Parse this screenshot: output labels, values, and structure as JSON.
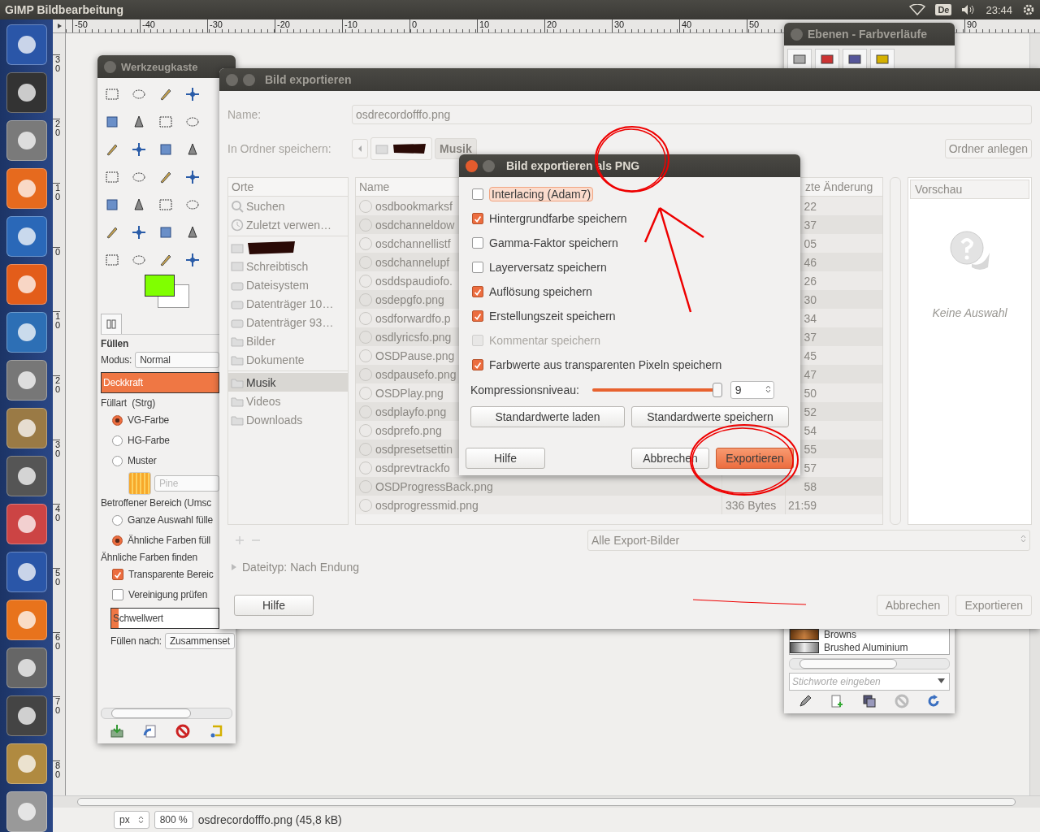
{
  "top_bar": {
    "title": "GIMP Bildbearbeitung",
    "keyboard_layout": "De",
    "clock": "23:44"
  },
  "ruler_top": {
    "labels": [
      "-50",
      "-40",
      "-30",
      "-20",
      "-10",
      "0",
      "10",
      "20",
      "30",
      "40",
      "50"
    ],
    "end_labels": [
      "90"
    ]
  },
  "ruler_left": {
    "labels": [
      "30",
      "20",
      "10",
      "0",
      "10",
      "20",
      "30",
      "40",
      "50",
      "60",
      "70",
      "80"
    ]
  },
  "toolbox": {
    "title": "Werkzeugkaste",
    "options_title": "Füllen",
    "mode_label": "Modus:",
    "mode": "Normal",
    "opacity": {
      "label": "Deckkraft",
      "level": 1
    },
    "fill_type_label": "Füllart  (Strg)",
    "fill_types": [
      {
        "label": "VG-Farbe",
        "selected": true
      },
      {
        "label": "HG-Farbe",
        "selected": false
      },
      {
        "label": "Muster",
        "selected": false
      }
    ],
    "pattern": "Pine",
    "area_label": "Betroffener Bereich (Umsc",
    "areas": [
      {
        "label": "Ganze Auswahl fülle",
        "selected": false
      },
      {
        "label": "Ähnliche Farben füll",
        "selected": true
      }
    ],
    "find_label": "Ähnliche Farben finden",
    "find_options": [
      {
        "label": "Transparente Bereic",
        "checked": true
      },
      {
        "label": "Vereinigung prüfen",
        "checked": false
      }
    ],
    "threshold": {
      "label": "Schwellwert",
      "level": 0.07
    },
    "fill_by_label": "Füllen nach:",
    "fill_by": "Zusammenset"
  },
  "layers_window": {
    "title": "Ebenen - Farbverläufe",
    "gradients": [
      "Browns",
      "Brushed Aluminium"
    ],
    "tag_placeholder": "Stichworte eingeben"
  },
  "export_dialog": {
    "title": "Bild exportieren",
    "name_label": "Name:",
    "name_value": "osdrecordofffo.png",
    "folder_label": "In Ordner speichern:",
    "path": [
      {
        "kind": "redacted",
        "selected": false
      },
      {
        "kind": "folder",
        "label": "Musik",
        "selected": true
      }
    ],
    "create_folder": "Ordner anlegen",
    "places_header": "Orte",
    "place_groups": [
      [
        {
          "kind": "search",
          "label": "Suchen",
          "selected": false
        },
        {
          "kind": "recent",
          "label": "Zuletzt verwen…",
          "selected": false
        }
      ],
      [
        {
          "kind": "redacted",
          "selected": false
        },
        {
          "kind": "desktop",
          "label": "Schreibtisch",
          "selected": false
        },
        {
          "kind": "drive",
          "label": "Dateisystem",
          "selected": false
        },
        {
          "kind": "drive",
          "label": "Datenträger 10…",
          "selected": false
        },
        {
          "kind": "drive",
          "label": "Datenträger 93…",
          "selected": false
        },
        {
          "kind": "folder",
          "label": "Bilder",
          "selected": false
        },
        {
          "kind": "folder",
          "label": "Dokumente",
          "selected": false
        }
      ],
      [
        {
          "kind": "folder",
          "label": "Musik",
          "selected": true
        },
        {
          "kind": "folder",
          "label": "Videos",
          "selected": false
        },
        {
          "kind": "folder",
          "label": "Downloads",
          "selected": false
        }
      ]
    ],
    "columns": {
      "name": "Name",
      "modified": "zte Änderung"
    },
    "files": [
      {
        "name": "osdbookmarksf",
        "modified": "22"
      },
      {
        "name": "osdchanneldow",
        "modified": "37"
      },
      {
        "name": "osdchannellistf",
        "modified": "05"
      },
      {
        "name": "osdchannelupf",
        "modified": "46"
      },
      {
        "name": "osddspaudiofo.",
        "modified": "26"
      },
      {
        "name": "osdepgfo.png",
        "modified": "30"
      },
      {
        "name": "osdforwardfo.p",
        "modified": "34"
      },
      {
        "name": "osdlyricsfo.png",
        "modified": "37"
      },
      {
        "name": "OSDPause.png",
        "modified": "45"
      },
      {
        "name": "osdpausefo.png",
        "modified": "47"
      },
      {
        "name": "OSDPlay.png",
        "modified": "50"
      },
      {
        "name": "osdplayfo.png",
        "modified": "52"
      },
      {
        "name": "osdprefo.png",
        "modified": "54"
      },
      {
        "name": "osdpresetsettin",
        "modified": "55"
      },
      {
        "name": "osdprevtrackfo",
        "modified": "57"
      },
      {
        "name": "OSDProgressBack.png",
        "modified": "58"
      },
      {
        "name": "osdprogressmid.png",
        "size": "336 Bytes",
        "modified": "21:59"
      }
    ],
    "preview_header": "Vorschau",
    "preview_empty": "Keine Auswahl",
    "filter": "Alle Export-Bilder",
    "file_type": "Dateityp: Nach Endung",
    "help": "Hilfe",
    "cancel": "Abbrechen",
    "export": "Exportieren"
  },
  "png_dialog": {
    "title": "Bild exportieren als PNG",
    "options": [
      {
        "label": "Interlacing (Adam7)",
        "checked": false,
        "disabled": false,
        "focused": true
      },
      {
        "label": "Hintergrundfarbe speichern",
        "checked": true,
        "disabled": false,
        "focused": false
      },
      {
        "label": "Gamma-Faktor speichern",
        "checked": false,
        "disabled": false,
        "focused": false
      },
      {
        "label": "Layerversatz speichern",
        "checked": false,
        "disabled": false,
        "focused": false
      },
      {
        "label": "Auflösung speichern",
        "checked": true,
        "disabled": false,
        "focused": false
      },
      {
        "label": "Erstellungszeit speichern",
        "checked": true,
        "disabled": false,
        "focused": false
      },
      {
        "label": "Kommentar speichern",
        "checked": false,
        "disabled": true,
        "focused": false
      },
      {
        "label": "Farbwerte aus transparenten Pixeln speichern",
        "checked": true,
        "disabled": false,
        "focused": false
      }
    ],
    "compression": {
      "label": "Kompressionsniveau:",
      "level": 1,
      "value": "9"
    },
    "load_defaults": "Standardwerte laden",
    "save_defaults": "Standardwerte speichern",
    "help": "Hilfe",
    "cancel": "Abbrechen",
    "export": "Exportieren"
  },
  "status_bar": {
    "unit": "px",
    "zoom": "800 %",
    "file": "osdrecordofffo.png (45,8 kB)"
  }
}
